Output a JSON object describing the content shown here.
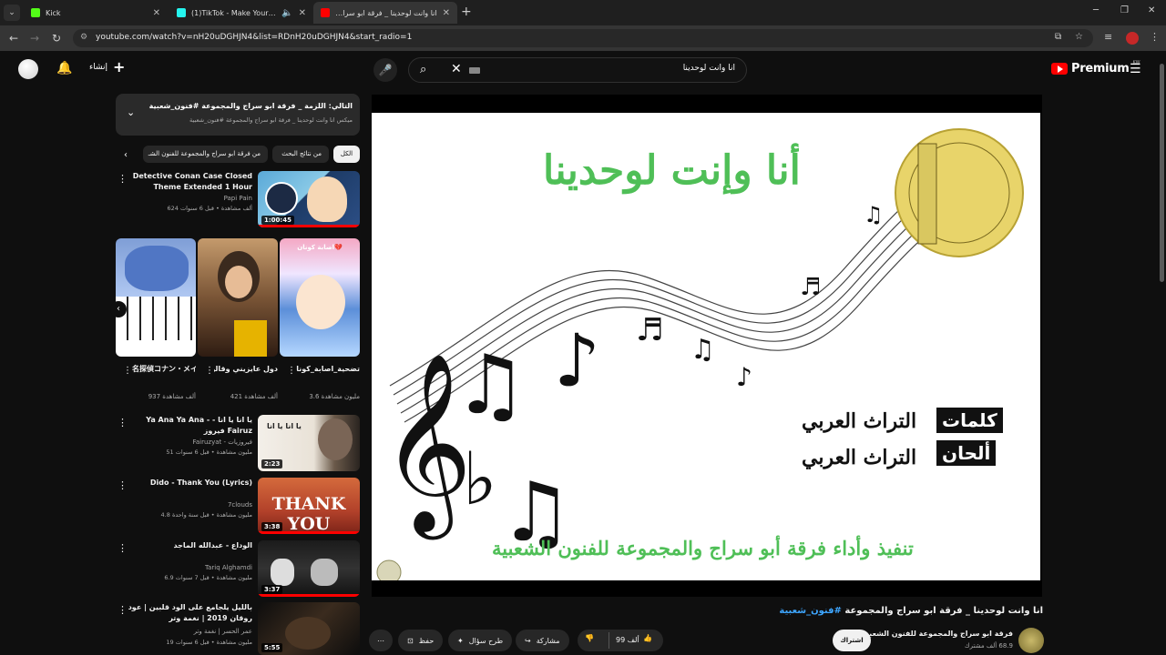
{
  "browser": {
    "tabs": [
      {
        "title": "Kick",
        "favicon_color": "#53fc18"
      },
      {
        "title": "(1)TikTok - Make Your Day",
        "favicon_color": "#25f4ee"
      },
      {
        "title": "انا وانت لوحدينا _ فرقة ابو سراج وا",
        "favicon_color": "#ff0000"
      }
    ],
    "url": "youtube.com/watch?v=nH20uDGHJN4&list=RDnH20uDGHJN4&start_radio=1"
  },
  "yt_header": {
    "create_label": "إنشاء",
    "search_value": "انا وانت لوحدينا",
    "premium_label": "Premium",
    "region": "KW"
  },
  "playlist": {
    "title": "التالي: اللزمة _ فرقة ابو سراج والمجموعة #فنون_شعبية",
    "subtitle": "ميكس انا وانت لوحدينا _ فرقة ابو سراج والمجموعة #فنون_شعبية"
  },
  "chips": [
    "الكل",
    "من نتائج البحث",
    "من فرقة ابو سراج والمجموعة للفنون الشـ"
  ],
  "recs_top": [
    {
      "title": "Detective Conan Case Closed Theme Extended 1 Hour",
      "channel": "Papi Pain",
      "meta": "624 ألف مشاهدة • قبل 6 سنوات",
      "duration": "1:00:45"
    }
  ],
  "shorts": [
    {
      "title": "تضحية_اصابة_كونان 💔 طل..رتيهو..😢",
      "views": "3.6 مليون مشاهدة"
    },
    {
      "title": "دول عايزيني وقالولي يا اسمر ...",
      "views": "421 ألف مشاهدة"
    },
    {
      "title": "名探偵コナン・メインテーマ",
      "views": "937 ألف مشاهدة"
    }
  ],
  "recs_bottom": [
    {
      "title": "Ya Ana Ya Ana - يا انا يا انا - فيروز Fairuz",
      "channel": "Fairuzyat - فيروزيات",
      "meta": "51 مليون مشاهدة • قبل 6 سنوات",
      "duration": "2:23"
    },
    {
      "title": "Dido - Thank You (Lyrics)",
      "channel": "7clouds",
      "meta": "4.8 مليون مشاهدة • قبل سنة واحدة",
      "duration": "3:38"
    },
    {
      "title": "الوداع - عبدالله الماجد",
      "channel": "Tariq Alghamdi",
      "meta": "6.9 مليون مشاهدة • قبل 7 سنوات",
      "duration": "3:37"
    },
    {
      "title": "بالليل يلجامع على الود قلبين | عود روقان 2019 | نغمة وتر",
      "channel": "عمر الحسر | نغمة وتر",
      "meta": "19 مليون مشاهدة • قبل 6 سنوات",
      "duration": "5:55"
    }
  ],
  "video": {
    "frame_title": "أنا وإنت لوحدينا",
    "lyrics_label": "كلمات",
    "lyrics_value": "التراث العربي",
    "melody_label": "ألحان",
    "melody_value": "التراث العربي",
    "footer": "تنفيذ وأداء فرقة أبو سراج والمجموعة للفنون الشعبية",
    "title": "انا وانت لوحدينا _ فرقة ابو سراج والمجموعة",
    "hashtag": "#فنون_شعبية"
  },
  "channel": {
    "name": "فرقة ابو سراج والمجموعة للفنون الشعبية",
    "subs": "68.9 ألف مشترك",
    "subscribe_label": "اشتراك"
  },
  "actions": {
    "likes": "99 ألف",
    "share": "مشاركة",
    "ask": "طرح سؤال",
    "save": "حفظ"
  }
}
